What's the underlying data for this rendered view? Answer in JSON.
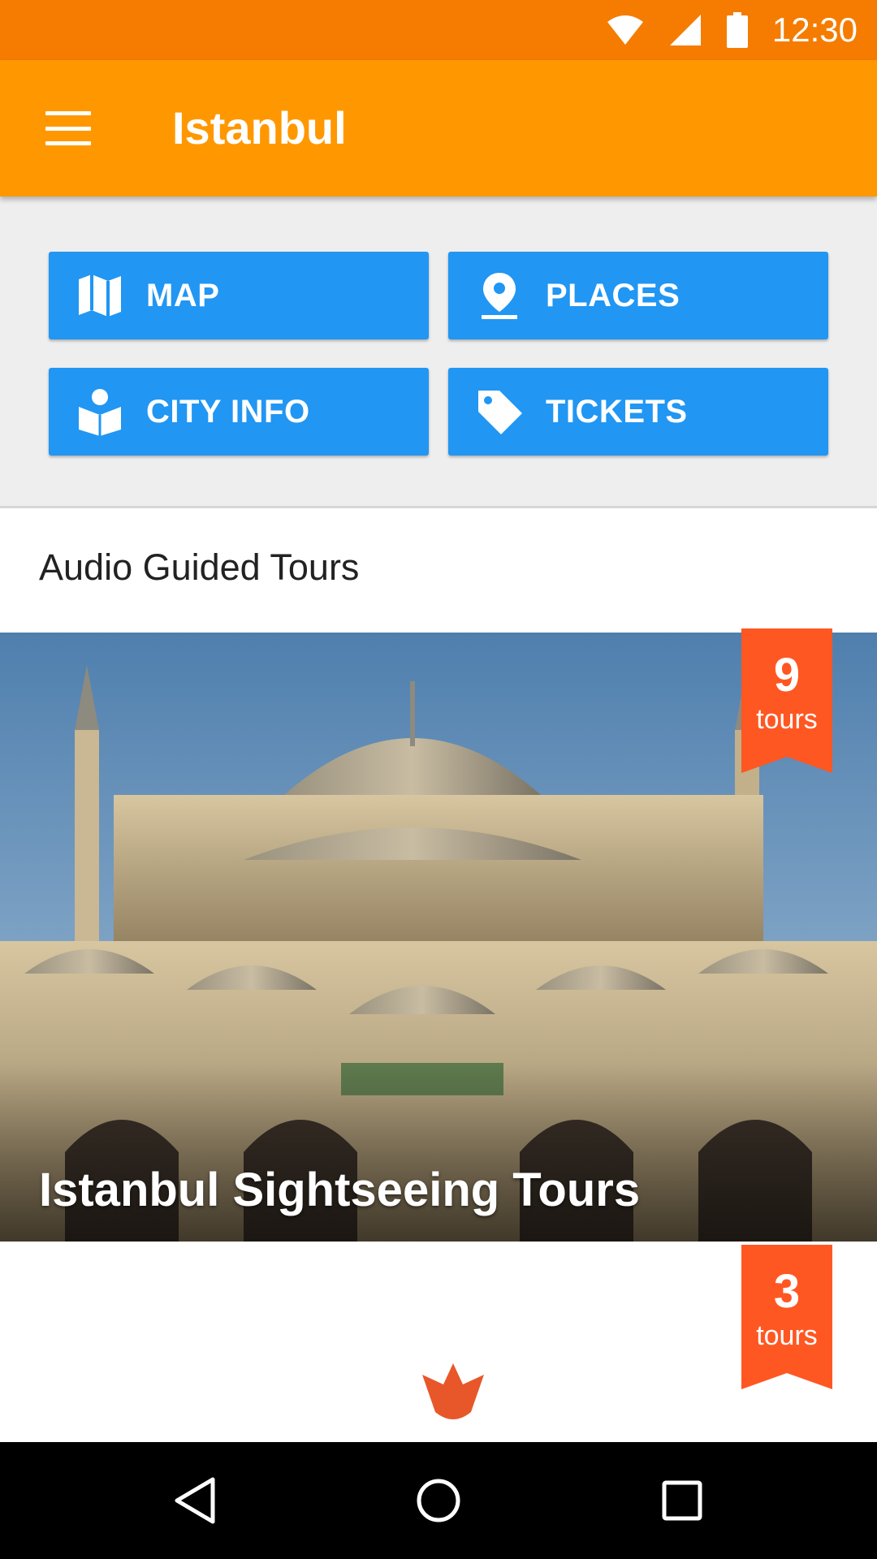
{
  "status_bar": {
    "time": "12:30",
    "icons": [
      "wifi-icon",
      "cell-signal-icon",
      "battery-icon"
    ],
    "color": "#f57c00"
  },
  "app_bar": {
    "title": "Istanbul",
    "menu_icon": "hamburger-menu-icon",
    "color": "#ff9800"
  },
  "quick_actions": [
    {
      "label": "MAP",
      "icon": "map-icon"
    },
    {
      "label": "PLACES",
      "icon": "place-pin-icon"
    },
    {
      "label": "CITY INFO",
      "icon": "book-reader-icon"
    },
    {
      "label": "TICKETS",
      "icon": "tag-icon"
    }
  ],
  "quick_action_color": "#2196f3",
  "section": {
    "title": "Audio Guided Tours"
  },
  "tours": [
    {
      "title": "Istanbul Sightseeing Tours",
      "count": "9",
      "unit": "tours"
    },
    {
      "title": "",
      "count": "3",
      "unit": "tours"
    }
  ],
  "badge_color": "#ff5722",
  "nav_bar": {
    "buttons": [
      "back-icon",
      "home-icon",
      "recents-icon"
    ]
  }
}
